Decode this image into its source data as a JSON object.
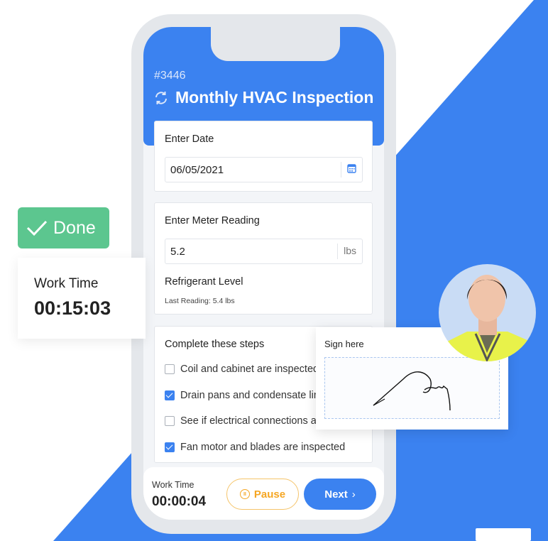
{
  "colors": {
    "brand": "#3b82f0",
    "done": "#5cc68f",
    "pause": "#f5a623"
  },
  "header": {
    "ticket": "#3446",
    "title": "Monthly HVAC Inspection",
    "icon": "refresh-icon"
  },
  "date_card": {
    "label": "Enter Date",
    "value": "06/05/2021",
    "icon": "calendar-icon"
  },
  "meter_card": {
    "label": "Enter Meter Reading",
    "value": "5.2",
    "unit": "lbs",
    "sub_label": "Refrigerant Level",
    "last_reading": "Last Reading: 5.4 lbs"
  },
  "steps_card": {
    "title": "Complete these steps",
    "steps": [
      {
        "label": "Coil and cabinet are inspected",
        "checked": false
      },
      {
        "label": "Drain pans and condensate lines",
        "checked": true
      },
      {
        "label": "See if electrical connections are",
        "checked": false
      },
      {
        "label": "Fan motor and blades are inspected",
        "checked": true
      }
    ]
  },
  "footer": {
    "work_time_label": "Work Time",
    "work_time": "00:00:04",
    "pause": "Pause",
    "next": "Next"
  },
  "done_badge": {
    "label": "Done"
  },
  "work_time_card": {
    "label": "Work Time",
    "value": "00:15:03"
  },
  "signature": {
    "label": "Sign here"
  }
}
